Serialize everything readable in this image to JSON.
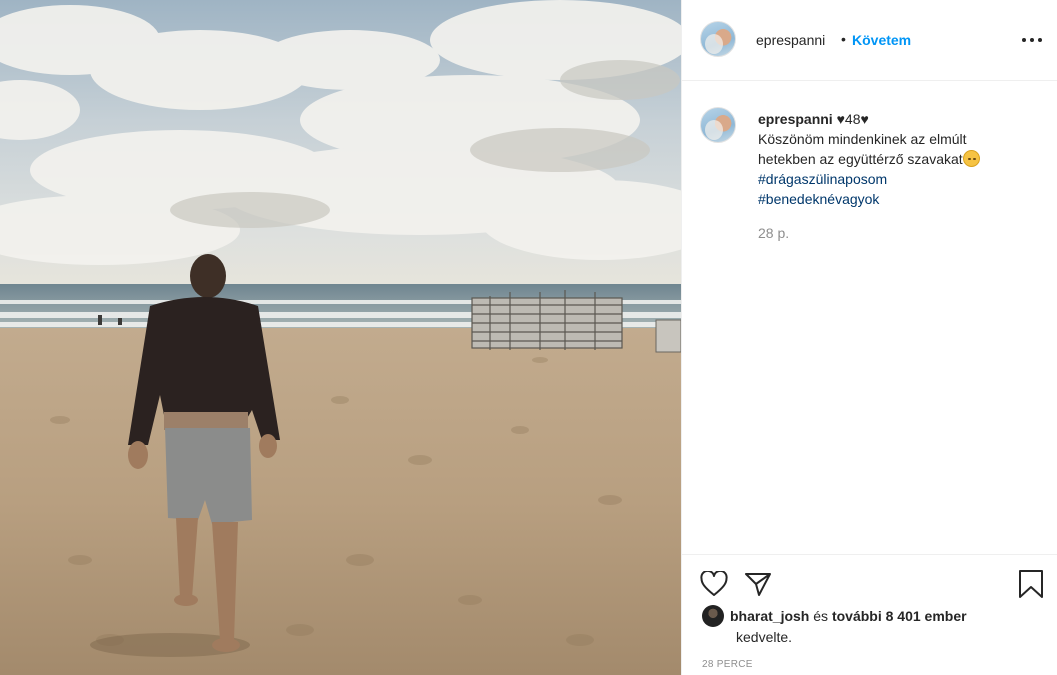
{
  "post": {
    "author": "eprespanni",
    "follow_dot": "•",
    "follow_label": "Követem",
    "caption": {
      "username": "eprespanni",
      "heart_text": "♥48♥",
      "text": "Köszönöm mindenkinek az elmúlt hetekben az együttérző szavakat",
      "hashtags": [
        "#drágaszülinaposom",
        "#benedeknévagyok"
      ],
      "time_ago": "28 p."
    },
    "likes": {
      "first_user": "bharat_josh",
      "connector": "és",
      "others": "további 8 401 ember",
      "suffix": "kedvelte."
    },
    "date": "28 PERCE"
  },
  "icons": {
    "more": "more-options-icon",
    "like": "heart-icon",
    "share": "paper-plane-icon",
    "save": "bookmark-icon",
    "caption_emoji": "sad-face-emoji"
  },
  "colors": {
    "accent": "#0095f6",
    "hashtag": "#00376b",
    "muted": "#8e8e8e",
    "text": "#262626",
    "border": "#efefef"
  }
}
